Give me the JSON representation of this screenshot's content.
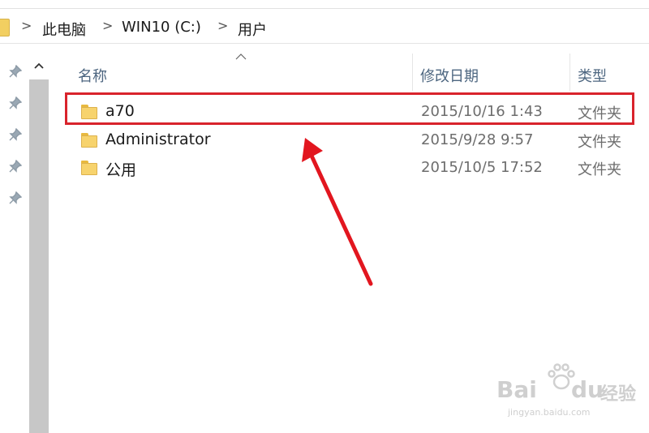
{
  "address_bar": {
    "crumbs": [
      "此电脑",
      "WIN10 (C:)",
      "用户"
    ],
    "separator": ">"
  },
  "columns": {
    "name": "名称",
    "modified": "修改日期",
    "type": "类型"
  },
  "files": [
    {
      "name": "a70",
      "modified": "2015/10/16 1:43",
      "type": "文件夹"
    },
    {
      "name": "Administrator",
      "modified": "2015/9/28 9:57",
      "type": "文件夹"
    },
    {
      "name": "公用",
      "modified": "2015/10/5 17:52",
      "type": "文件夹"
    }
  ],
  "watermark": {
    "brand": "Bai",
    "brand_suffix": "du",
    "product": "经验",
    "url": "jingyan.baidu.com"
  },
  "colors": {
    "highlight": "#d9232c",
    "folder": "#f7d36d",
    "header_text": "#4d6680"
  },
  "icons": {
    "pin": "pin-icon",
    "folder": "folder-icon",
    "scroll_up": "scroll-up-arrow-icon",
    "sort": "sort-ascending-caret-icon"
  }
}
